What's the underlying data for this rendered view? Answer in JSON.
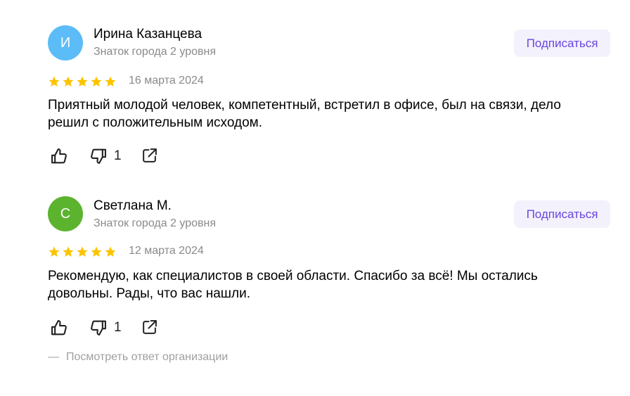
{
  "reviews": [
    {
      "avatar_letter": "И",
      "avatar_color": "#5bbcf7",
      "name": "Ирина Казанцева",
      "level": "Знаток города 2 уровня",
      "subscribe_label": "Подписаться",
      "rating": 5,
      "date": "16 марта 2024",
      "text": "Приятный молодой человек, компетентный, встретил в офисе, был на связи, дело решил с положительным исходом.",
      "dislike_count": "1"
    },
    {
      "avatar_letter": "С",
      "avatar_color": "#5cb32e",
      "name": "Светлана М.",
      "level": "Знаток города 2 уровня",
      "subscribe_label": "Подписаться",
      "rating": 5,
      "date": "12 марта 2024",
      "text": "Рекомендую, как специалистов в своей области. Спасибо за всё! Мы остались довольны. Рады, что вас нашли.",
      "dislike_count": "1"
    }
  ],
  "org_reply": {
    "dash": "—",
    "label": "Посмотреть ответ организации"
  },
  "colors": {
    "star": "#fcc400",
    "accent": "#6a45e0",
    "muted": "#8a8a8a"
  },
  "icons": [
    "thumbs-up-icon",
    "thumbs-down-icon",
    "share-icon",
    "star-icon"
  ]
}
